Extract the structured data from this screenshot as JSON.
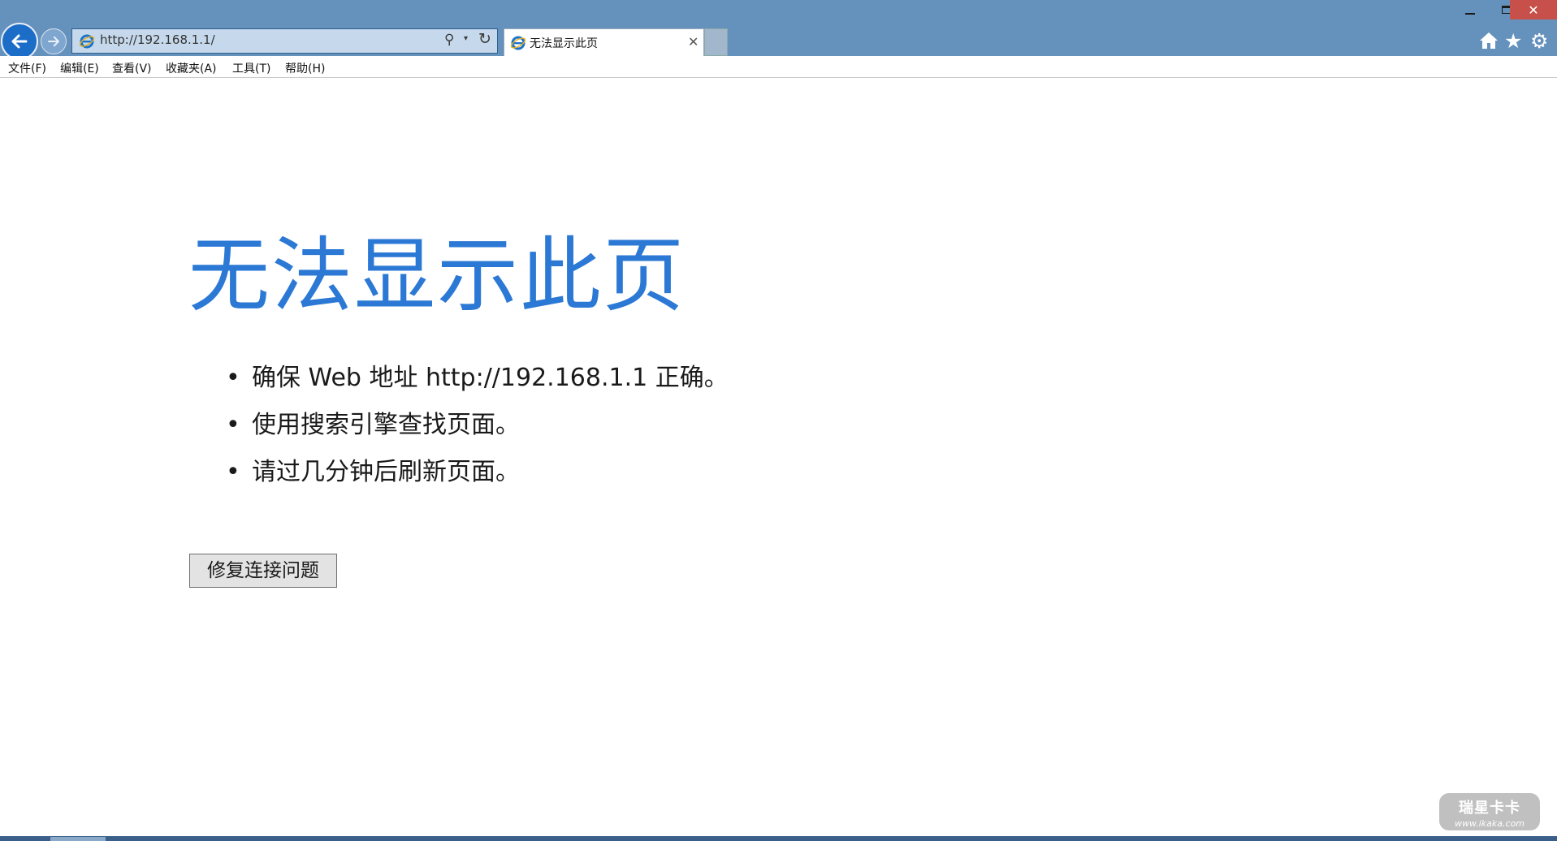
{
  "browser": {
    "address_url": "http://192.168.1.1/",
    "tab_title": "无法显示此页",
    "tab_close": "✕",
    "icons": [
      "back-arrow-icon",
      "forward-arrow-icon",
      "ie-logo-icon",
      "search-icon",
      "dropdown-icon",
      "refresh-icon",
      "close-icon",
      "home-icon",
      "star-icon",
      "gear-icon",
      "minimize-icon",
      "maximize-icon"
    ],
    "win_close": "✕",
    "search_glyph": "⚲",
    "dropdown_glyph": "▾",
    "refresh_glyph": "↻",
    "star_glyph": "★",
    "gear_glyph": "⚙"
  },
  "menu": {
    "items": [
      "文件(F)",
      "编辑(E)",
      "查看(V)",
      "收藏夹(A)",
      "工具(T)",
      "帮助(H)"
    ]
  },
  "content": {
    "title": "无法显示此页",
    "bullet": "•",
    "tips": [
      "确保 Web 地址 http://192.168.1.1 正确。",
      "使用搜索引擎查找页面。",
      "请过几分钟后刷新页面。"
    ],
    "fix_button": "修复连接问题"
  },
  "watermark": {
    "logo_text": "瑞星卡卡",
    "url_text": "www.ikaka.com"
  },
  "colors": {
    "chrome": "#6591bd",
    "title_blue": "#2b79d5",
    "close_red": "#c7504a"
  }
}
